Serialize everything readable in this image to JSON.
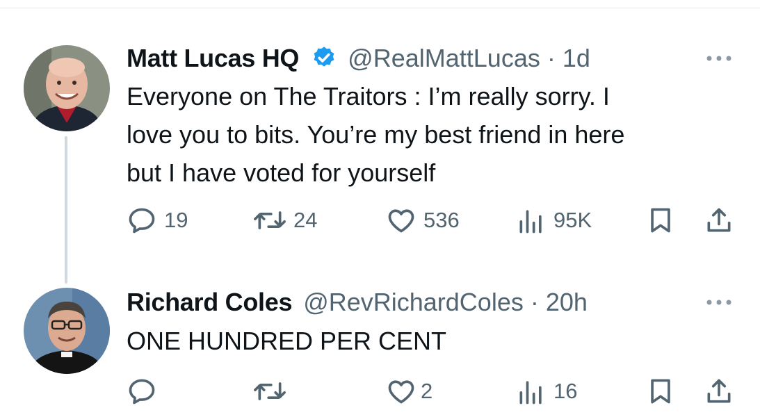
{
  "tweets": [
    {
      "name": "Matt Lucas HQ",
      "verified": true,
      "handle": "@RealMattLucas",
      "separator": "·",
      "time": "1d",
      "lines": [
        "Everyone on The Traitors : I’m really sorry. I",
        "love you to bits. You’re my best friend in here",
        "but I have voted for yourself"
      ],
      "reply_count": "19",
      "retweet_count": "24",
      "like_count": "536",
      "view_count": "95K"
    },
    {
      "name": "Richard Coles",
      "verified": false,
      "handle": "@RevRichardColes",
      "separator": "·",
      "time": "20h",
      "lines": [
        "ONE HUNDRED PER CENT"
      ],
      "reply_count": "",
      "retweet_count": "",
      "like_count": "2",
      "view_count": "16"
    }
  ],
  "colors": {
    "text": "#0f1419",
    "secondary": "#536471",
    "verified": "#1d9bf0",
    "thread_line": "#cfd9de"
  },
  "icons": [
    "verified-badge-icon",
    "more-icon",
    "reply-icon",
    "retweet-icon",
    "like-icon",
    "views-icon",
    "bookmark-icon",
    "share-icon"
  ]
}
